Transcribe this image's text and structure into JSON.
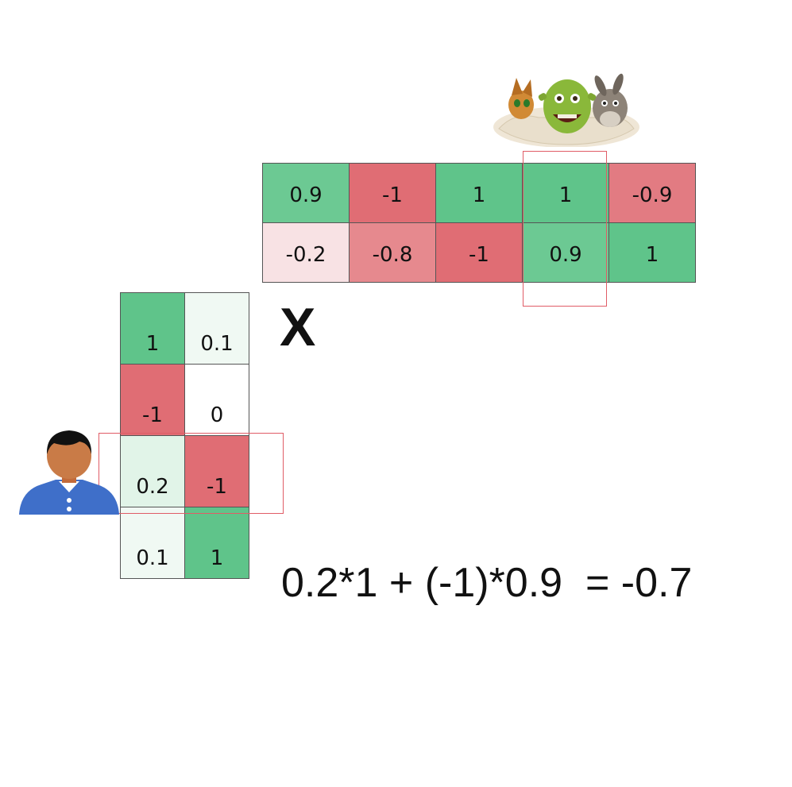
{
  "item_matrix": {
    "rows": [
      [
        {
          "value": "0.9",
          "color": "#6cc993"
        },
        {
          "value": "-1",
          "color": "#e06d74"
        },
        {
          "value": "1",
          "color": "#5fc48a"
        },
        {
          "value": "1",
          "color": "#5fc48a"
        },
        {
          "value": "-0.9",
          "color": "#e27b82"
        }
      ],
      [
        {
          "value": "-0.2",
          "color": "#f8e2e4"
        },
        {
          "value": "-0.8",
          "color": "#e6898e"
        },
        {
          "value": "-1",
          "color": "#e06d74"
        },
        {
          "value": "0.9",
          "color": "#6cc993"
        },
        {
          "value": "1",
          "color": "#5fc48a"
        }
      ]
    ]
  },
  "user_matrix": {
    "rows": [
      [
        {
          "value": "1",
          "color": "#5fc48a"
        },
        {
          "value": "0.1",
          "color": "#f0f9f3"
        }
      ],
      [
        {
          "value": "-1",
          "color": "#e06d74"
        },
        {
          "value": "0",
          "color": "#ffffff"
        }
      ],
      [
        {
          "value": "0.2",
          "color": "#e1f4e8"
        },
        {
          "value": "-1",
          "color": "#e06d74"
        }
      ],
      [
        {
          "value": "0.1",
          "color": "#f0f9f3"
        },
        {
          "value": "1",
          "color": "#5fc48a"
        }
      ]
    ]
  },
  "operator": "X",
  "equation": "0.2*1 + (-1)*0.9  = -0.7",
  "highlight_color": "#e05c66",
  "icons": {
    "user": "person-avatar-icon",
    "movie": "shrek-characters-illustration"
  }
}
